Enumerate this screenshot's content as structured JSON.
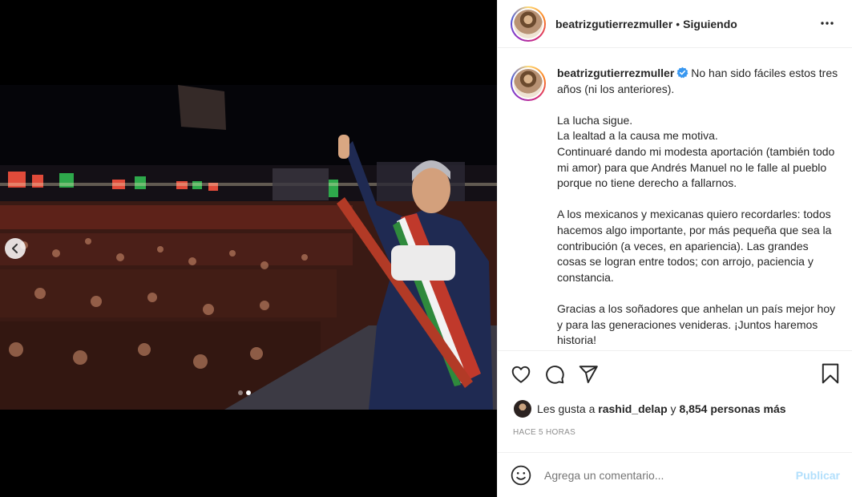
{
  "header": {
    "username": "beatrizgutierrezmuller",
    "separator": "•",
    "follow_status": "Siguiendo"
  },
  "caption": {
    "username": "beatrizgutierrezmuller",
    "paragraphs": [
      "No han sido fáciles estos tres años (ni los anteriores).",
      "La lucha sigue.\nLa lealtad a la causa me motiva.\nContinuaré dando mi modesta aportación (también todo mi amor) para que Andrés Manuel no le falle al pueblo porque no tiene derecho a fallarnos.",
      "A los mexicanos y mexicanas quiero recordarles: todos hacemos algo importante, por más pequeña que sea la contribución (a veces, en apariencia). Las grandes cosas se logran entre todos; con arrojo, paciencia y constancia.",
      "Gracias a los soñadores que anhelan un país mejor hoy y para las generaciones venideras. ¡Juntos haremos historia!"
    ]
  },
  "likes": {
    "prefix": "Les gusta a",
    "user": "rashid_delap",
    "connector": "y",
    "others": "8,854 personas más"
  },
  "timestamp": "HACE 5 HORAS",
  "comment": {
    "placeholder": "Agrega un comentario...",
    "publish_label": "Publicar"
  },
  "carousel": {
    "total": 2,
    "current": 2
  },
  "icons": [
    "more-options-icon",
    "verified-icon",
    "heart-icon",
    "comment-icon",
    "share-icon",
    "bookmark-icon",
    "emoji-icon",
    "chevron-left-icon"
  ],
  "colors": {
    "verified": "#3897f0",
    "publish_disabled": "#b2dffc",
    "muted": "#8e8e8e"
  }
}
